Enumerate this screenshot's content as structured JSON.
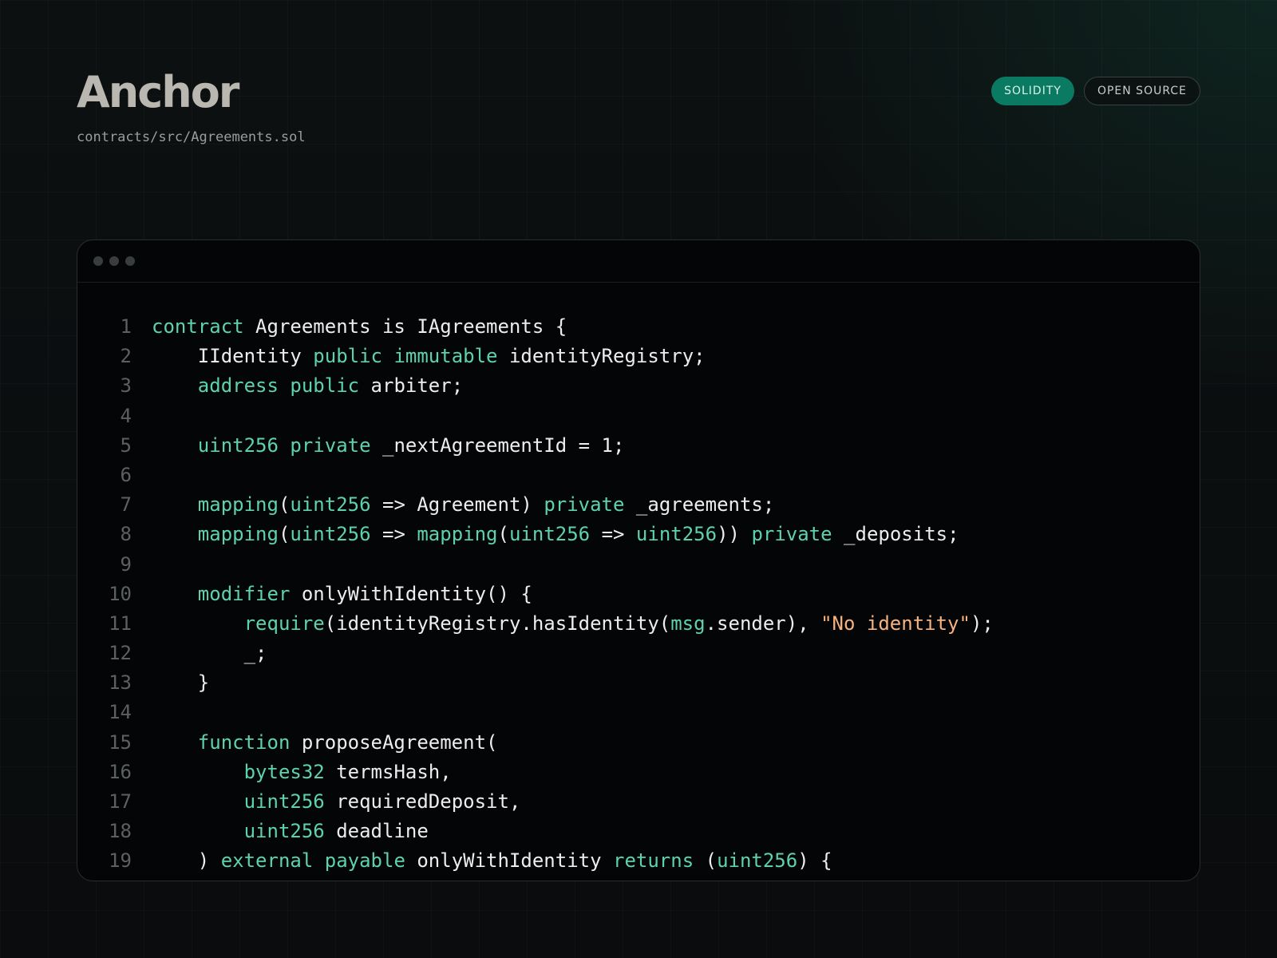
{
  "header": {
    "title": "Anchor",
    "file_path": "contracts/src/Agreements.sol"
  },
  "badges": [
    "SOLIDITY",
    "OPEN SOURCE"
  ],
  "colors": {
    "accent": "#0b7a63",
    "keyword": "#5ed2ad",
    "string": "#f7b27e",
    "line_number": "#5c6060",
    "text": "#ededed"
  },
  "code": {
    "lines": [
      {
        "n": "1",
        "tokens": [
          {
            "t": "contract",
            "c": "kw"
          },
          {
            "t": " Agreements is IAgreements {"
          }
        ]
      },
      {
        "n": "2",
        "tokens": [
          {
            "t": "    IIdentity "
          },
          {
            "t": "public",
            "c": "kw"
          },
          {
            "t": " "
          },
          {
            "t": "immutable",
            "c": "kw"
          },
          {
            "t": " identityRegistry;"
          }
        ]
      },
      {
        "n": "3",
        "tokens": [
          {
            "t": "    "
          },
          {
            "t": "address",
            "c": "kw"
          },
          {
            "t": " "
          },
          {
            "t": "public",
            "c": "kw"
          },
          {
            "t": " arbiter;"
          }
        ]
      },
      {
        "n": "4",
        "tokens": []
      },
      {
        "n": "5",
        "tokens": [
          {
            "t": "    "
          },
          {
            "t": "uint256",
            "c": "kw"
          },
          {
            "t": " "
          },
          {
            "t": "private",
            "c": "kw"
          },
          {
            "t": " _nextAgreementId = 1;"
          }
        ]
      },
      {
        "n": "6",
        "tokens": []
      },
      {
        "n": "7",
        "tokens": [
          {
            "t": "    "
          },
          {
            "t": "mapping",
            "c": "kw"
          },
          {
            "t": "("
          },
          {
            "t": "uint256",
            "c": "kw"
          },
          {
            "t": " => Agreement) "
          },
          {
            "t": "private",
            "c": "kw"
          },
          {
            "t": " _agreements;"
          }
        ]
      },
      {
        "n": "8",
        "tokens": [
          {
            "t": "    "
          },
          {
            "t": "mapping",
            "c": "kw"
          },
          {
            "t": "("
          },
          {
            "t": "uint256",
            "c": "kw"
          },
          {
            "t": " => "
          },
          {
            "t": "mapping",
            "c": "kw"
          },
          {
            "t": "("
          },
          {
            "t": "uint256",
            "c": "kw"
          },
          {
            "t": " => "
          },
          {
            "t": "uint256",
            "c": "kw"
          },
          {
            "t": ")) "
          },
          {
            "t": "private",
            "c": "kw"
          },
          {
            "t": " _deposits;"
          }
        ]
      },
      {
        "n": "9",
        "tokens": []
      },
      {
        "n": "10",
        "tokens": [
          {
            "t": "    "
          },
          {
            "t": "modifier",
            "c": "kw"
          },
          {
            "t": " onlyWithIdentity() {"
          }
        ]
      },
      {
        "n": "11",
        "tokens": [
          {
            "t": "        "
          },
          {
            "t": "require",
            "c": "kw"
          },
          {
            "t": "(identityRegistry.hasIdentity("
          },
          {
            "t": "msg",
            "c": "kw"
          },
          {
            "t": ".sender), "
          },
          {
            "t": "\"No identity\"",
            "c": "str"
          },
          {
            "t": ");"
          }
        ]
      },
      {
        "n": "12",
        "tokens": [
          {
            "t": "        _;"
          }
        ]
      },
      {
        "n": "13",
        "tokens": [
          {
            "t": "    }"
          }
        ]
      },
      {
        "n": "14",
        "tokens": []
      },
      {
        "n": "15",
        "tokens": [
          {
            "t": "    "
          },
          {
            "t": "function",
            "c": "kw"
          },
          {
            "t": " proposeAgreement("
          }
        ]
      },
      {
        "n": "16",
        "tokens": [
          {
            "t": "        "
          },
          {
            "t": "bytes32",
            "c": "kw"
          },
          {
            "t": " termsHash,"
          }
        ]
      },
      {
        "n": "17",
        "tokens": [
          {
            "t": "        "
          },
          {
            "t": "uint256",
            "c": "kw"
          },
          {
            "t": " requiredDeposit,"
          }
        ]
      },
      {
        "n": "18",
        "tokens": [
          {
            "t": "        "
          },
          {
            "t": "uint256",
            "c": "kw"
          },
          {
            "t": " deadline"
          }
        ]
      },
      {
        "n": "19",
        "tokens": [
          {
            "t": "    ) "
          },
          {
            "t": "external",
            "c": "kw"
          },
          {
            "t": " "
          },
          {
            "t": "payable",
            "c": "kw"
          },
          {
            "t": " onlyWithIdentity "
          },
          {
            "t": "returns",
            "c": "kw"
          },
          {
            "t": " ("
          },
          {
            "t": "uint256",
            "c": "kw"
          },
          {
            "t": ") {"
          }
        ]
      }
    ]
  }
}
